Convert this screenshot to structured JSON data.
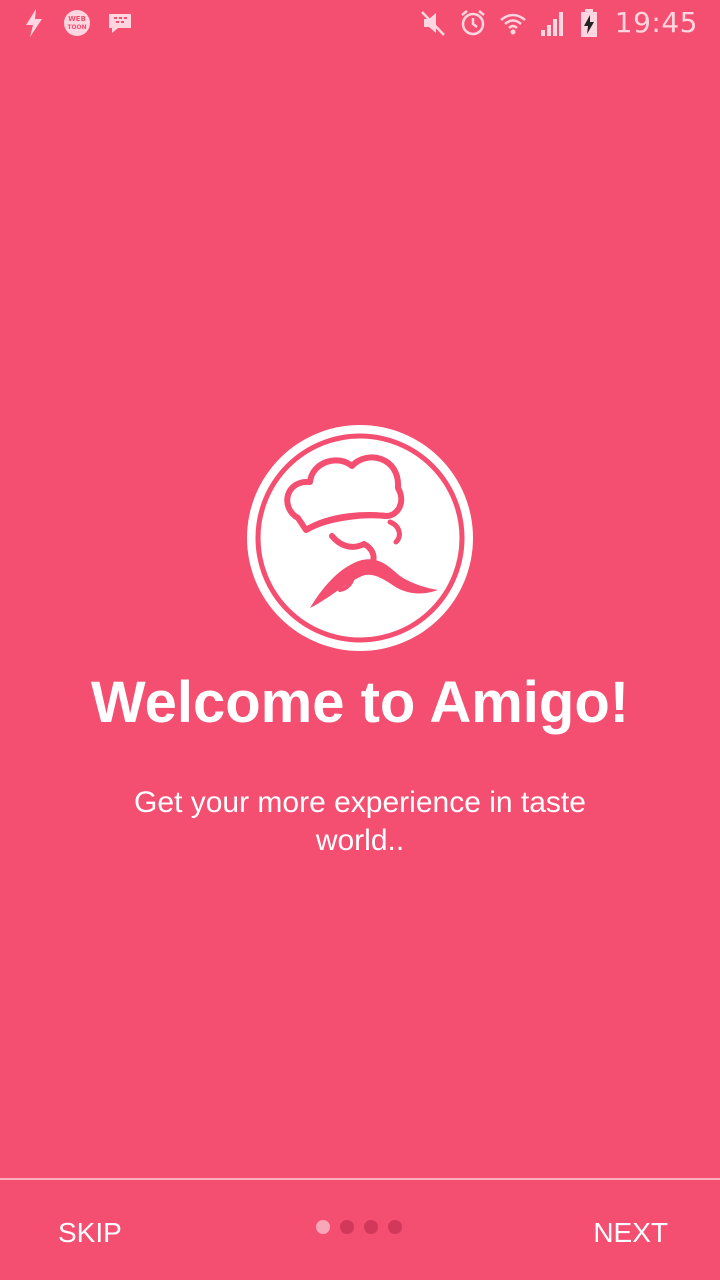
{
  "status_bar": {
    "time": "19:45",
    "left_icons": [
      "flash-icon",
      "webtoon-icon",
      "bbm-icon"
    ],
    "left_icon_text": {
      "webtoon_top": "WEB",
      "webtoon_bottom": "TOON"
    },
    "right_icons": [
      "mute-icon",
      "alarm-icon",
      "wifi-icon",
      "signal-icon",
      "battery-charging-icon"
    ]
  },
  "welcome": {
    "logo_icon": "chef-icon",
    "title": "Welcome to Amigo!",
    "subtitle": "Get your more experience in taste world.."
  },
  "navigation": {
    "skip_label": "SKIP",
    "next_label": "NEXT",
    "page_count": 4,
    "current_page": 1
  },
  "colors": {
    "background": "#F44E71",
    "text": "#FFFFFF",
    "dot_active": "#F7A7B8",
    "dot_inactive": "#D2385A"
  }
}
